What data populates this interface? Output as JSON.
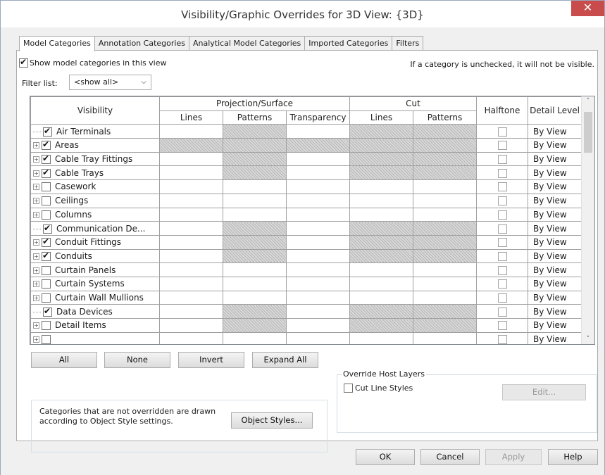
{
  "window": {
    "title": "Visibility/Graphic Overrides for 3D View: {3D}",
    "close_glyph": "✕"
  },
  "tabs": [
    {
      "label": "Model Categories",
      "active": true
    },
    {
      "label": "Annotation Categories",
      "active": false
    },
    {
      "label": "Analytical Model Categories",
      "active": false
    },
    {
      "label": "Imported Categories",
      "active": false
    },
    {
      "label": "Filters",
      "active": false
    }
  ],
  "show_model": {
    "label": "Show model categories in this view",
    "checked": true
  },
  "info_text": "If a category is unchecked, it will not be visible.",
  "filter": {
    "label": "Filter list:",
    "value": "<show all>",
    "chevron": "⌵"
  },
  "table": {
    "headers": {
      "visibility": "Visibility",
      "projection": "Projection/Surface",
      "cut": "Cut",
      "halftone": "Halftone",
      "detail_level": "Detail Level",
      "proj_lines": "Lines",
      "proj_patterns": "Patterns",
      "proj_transparency": "Transparency",
      "cut_lines": "Lines",
      "cut_patterns": "Patterns"
    },
    "rows": [
      {
        "name": "Air Terminals",
        "checked": true,
        "expandable": false,
        "detail": "By View",
        "hatch": [
          false,
          true,
          false,
          true,
          true
        ]
      },
      {
        "name": "Areas",
        "checked": true,
        "expandable": true,
        "detail": "By View",
        "hatch": [
          true,
          true,
          true,
          true,
          true
        ]
      },
      {
        "name": "Cable Tray Fittings",
        "checked": true,
        "expandable": true,
        "detail": "By View",
        "hatch": [
          false,
          true,
          false,
          true,
          true
        ]
      },
      {
        "name": "Cable Trays",
        "checked": true,
        "expandable": true,
        "detail": "By View",
        "hatch": [
          false,
          true,
          false,
          true,
          true
        ]
      },
      {
        "name": "Casework",
        "checked": false,
        "expandable": true,
        "detail": "By View",
        "hatch": [
          false,
          false,
          false,
          false,
          false
        ]
      },
      {
        "name": "Ceilings",
        "checked": false,
        "expandable": true,
        "detail": "By View",
        "hatch": [
          false,
          false,
          false,
          false,
          false
        ]
      },
      {
        "name": "Columns",
        "checked": false,
        "expandable": true,
        "detail": "By View",
        "hatch": [
          false,
          false,
          false,
          false,
          false
        ]
      },
      {
        "name": "Communication De...",
        "checked": true,
        "expandable": false,
        "detail": "By View",
        "hatch": [
          false,
          true,
          false,
          true,
          true
        ]
      },
      {
        "name": "Conduit Fittings",
        "checked": true,
        "expandable": true,
        "detail": "By View",
        "hatch": [
          false,
          true,
          false,
          true,
          true
        ]
      },
      {
        "name": "Conduits",
        "checked": true,
        "expandable": true,
        "detail": "By View",
        "hatch": [
          false,
          true,
          false,
          true,
          true
        ]
      },
      {
        "name": "Curtain Panels",
        "checked": false,
        "expandable": true,
        "detail": "By View",
        "hatch": [
          false,
          false,
          false,
          false,
          false
        ]
      },
      {
        "name": "Curtain Systems",
        "checked": false,
        "expandable": true,
        "detail": "By View",
        "hatch": [
          false,
          false,
          false,
          false,
          false
        ]
      },
      {
        "name": "Curtain Wall Mullions",
        "checked": false,
        "expandable": true,
        "detail": "By View",
        "hatch": [
          false,
          false,
          false,
          false,
          false
        ]
      },
      {
        "name": "Data Devices",
        "checked": true,
        "expandable": false,
        "detail": "By View",
        "hatch": [
          false,
          true,
          false,
          true,
          true
        ]
      },
      {
        "name": "Detail Items",
        "checked": false,
        "expandable": true,
        "detail": "By View",
        "hatch": [
          false,
          true,
          false,
          true,
          true
        ]
      },
      {
        "name": "",
        "checked": false,
        "expandable": true,
        "detail": "By View",
        "hatch": [
          false,
          false,
          false,
          false,
          false
        ]
      }
    ]
  },
  "buttons": {
    "all": "All",
    "none": "None",
    "invert": "Invert",
    "expand_all": "Expand All",
    "object_styles": "Object Styles...",
    "edit": "Edit...",
    "ok": "OK",
    "cancel": "Cancel",
    "apply": "Apply",
    "help": "Help"
  },
  "note": "Categories that are not overridden are drawn according to Object Style settings.",
  "override_host": {
    "legend": "Override Host Layers",
    "cut_line_label": "Cut Line Styles",
    "checked": false
  },
  "scrollbar": {
    "up_glyph": "˄",
    "down_glyph": "˅"
  }
}
